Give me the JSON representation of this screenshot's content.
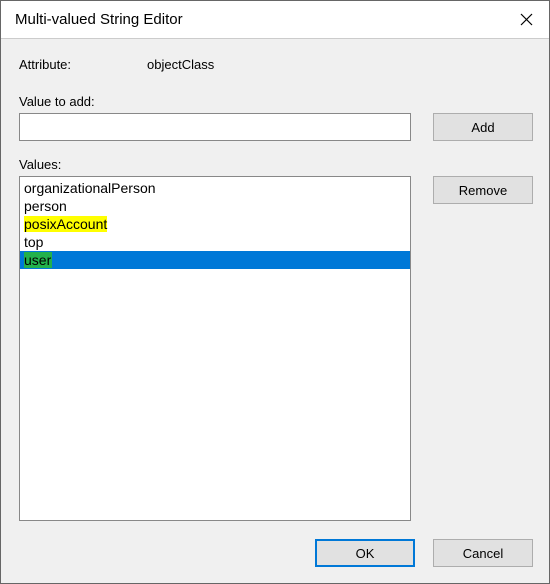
{
  "window": {
    "title": "Multi-valued String Editor"
  },
  "attribute": {
    "label": "Attribute:",
    "value": "objectClass"
  },
  "valueToAdd": {
    "label": "Value to add:",
    "input": ""
  },
  "buttons": {
    "add": "Add",
    "remove": "Remove",
    "ok": "OK",
    "cancel": "Cancel"
  },
  "valuesSection": {
    "label": "Values:",
    "items": [
      {
        "text": "organizationalPerson",
        "highlight": "none",
        "selected": false
      },
      {
        "text": "person",
        "highlight": "none",
        "selected": false
      },
      {
        "text": "posixAccount",
        "highlight": "yellow",
        "selected": false
      },
      {
        "text": "top",
        "highlight": "none",
        "selected": false
      },
      {
        "text": "user",
        "highlight": "green",
        "selected": true
      }
    ]
  }
}
